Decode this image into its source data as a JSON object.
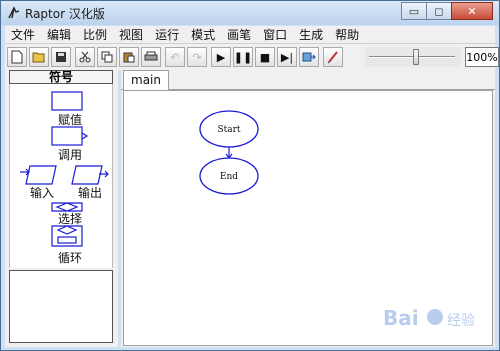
{
  "window": {
    "title": "Raptor 汉化版"
  },
  "window_buttons": {
    "minimize": "▭",
    "maximize": "◻",
    "close": "✕"
  },
  "menu": [
    "文件",
    "编辑",
    "比例",
    "视图",
    "运行",
    "模式",
    "画笔",
    "窗口",
    "生成",
    "帮助"
  ],
  "toolbar": {
    "zoom_value": "100%",
    "zoom_slider_fraction": 0.55
  },
  "palette": {
    "header": "符号",
    "symbols": [
      {
        "label": "赋值"
      },
      {
        "label": "调用"
      },
      {
        "label": "输入"
      },
      {
        "label": "输出"
      },
      {
        "label": "选择"
      },
      {
        "label": "循环"
      }
    ]
  },
  "tabs": [
    {
      "label": "main"
    }
  ],
  "flowchart": {
    "start_label": "Start",
    "end_label": "End",
    "stroke_color": "#1a1ad6"
  },
  "watermark": {
    "text": "Bai 经验"
  }
}
